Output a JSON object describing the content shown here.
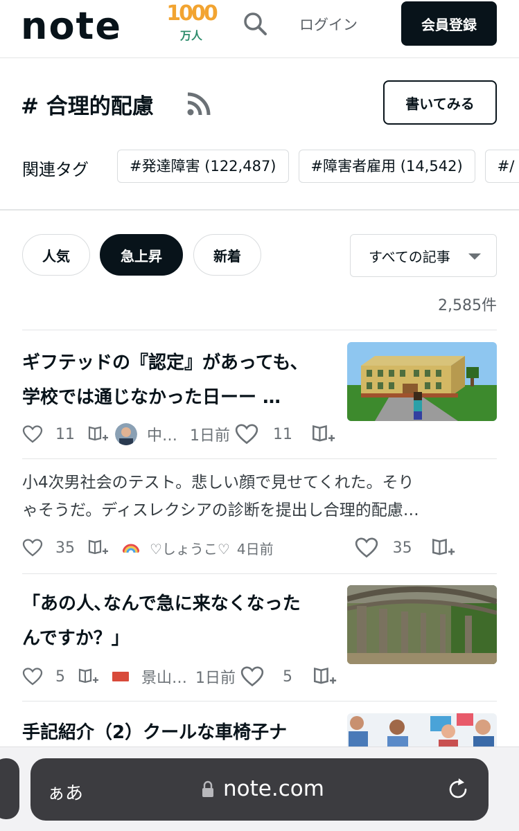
{
  "header": {
    "logo": "note",
    "badge_number": "1000",
    "badge_unit": "万人",
    "login_label": "ログイン",
    "signup_label": "会員登録"
  },
  "tag": {
    "title": "# 合理的配慮",
    "write_label": "書いてみる",
    "related_label": "関連タグ",
    "related_tags": [
      "#発達障害 (122,487)",
      "#障害者雇用 (14,542)",
      "#/"
    ]
  },
  "filters": {
    "tabs": [
      "人気",
      "急上昇",
      "新着"
    ],
    "active": "急上昇",
    "dropdown_value": "すべての記事",
    "count": "2,585件"
  },
  "articles": [
    {
      "title_line1": "ギフテッドの『認定』があっても、",
      "title_line2": "学校では通じなかった日ーー …",
      "likes_left": "11",
      "author": "中…",
      "time": "1日前",
      "likes_right": "11",
      "thumb": "minecraft-school"
    },
    {
      "body_line1": "小4次男社会のテスト。悲しい顔で見せてくれた。そり",
      "body_line2": "ゃそうだ。ディスレクシアの診断を提出し合理的配慮…",
      "likes_left": "35",
      "author": "♡しょうこ♡",
      "time": "4日前",
      "likes_right": "35"
    },
    {
      "title_line1": "「あの人､なんで急に来なくなった",
      "title_line2": "んですか？」",
      "likes_left": "5",
      "author": "景山…",
      "time": "1日前",
      "likes_right": "5",
      "thumb": "tree-tunnel"
    },
    {
      "title_line1": "手記紹介（2）クールな車椅子ナ",
      "thumb": "people-meeting"
    }
  ],
  "browser": {
    "aa_label": "ぁあ",
    "url": "note.com"
  },
  "colors": {
    "text": "#08131a",
    "border": "#d9dcde",
    "badge_orange": "#f2a431",
    "badge_green": "#2e8c6c"
  }
}
